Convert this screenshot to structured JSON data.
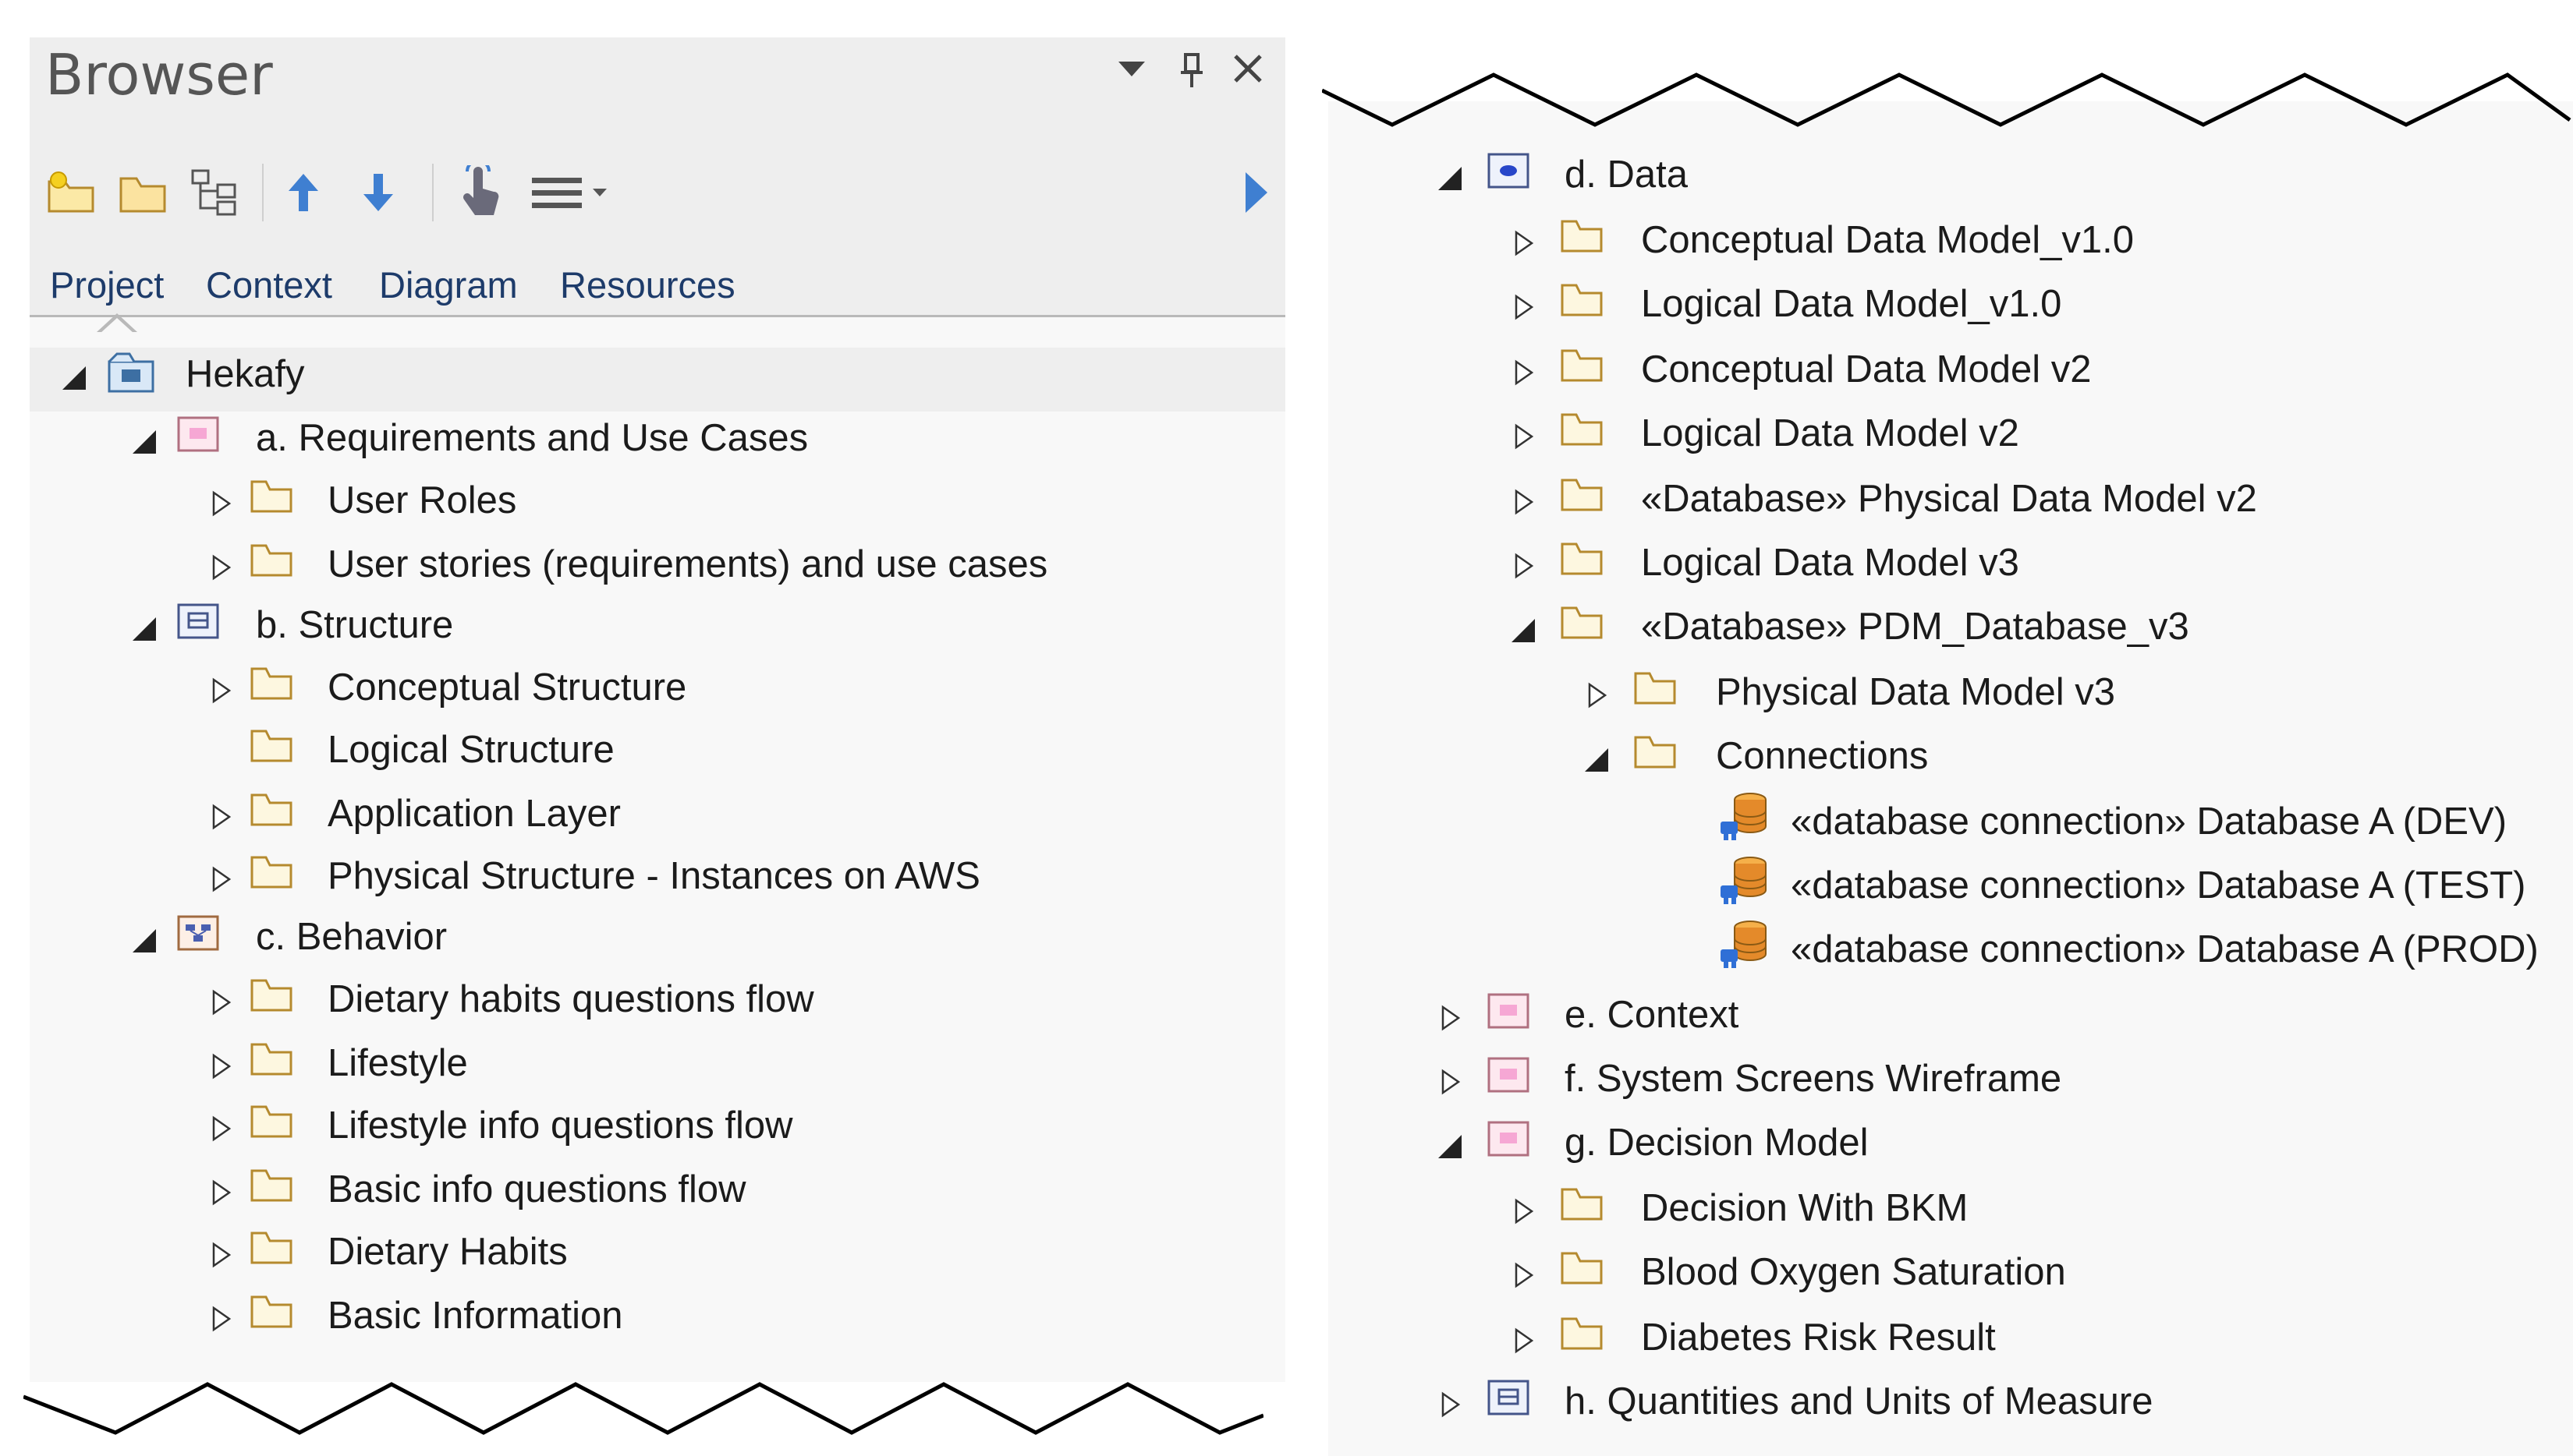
{
  "browser": {
    "title": "Browser",
    "controls": {
      "menu_glyph": "▾",
      "pin_glyph": "📌",
      "close_glyph": "✕"
    },
    "toolbar": {
      "icons": [
        "new-package-icon",
        "folder-icon",
        "hierarchy-icon",
        "arrow-up-icon",
        "arrow-down-icon",
        "touch-icon",
        "list-menu-icon",
        "play-icon"
      ]
    },
    "tabs": [
      "Project",
      "Context",
      "Diagram",
      "Resources"
    ],
    "active_tab": "Project"
  },
  "tree_left": [
    {
      "label": "Hekafy",
      "icon": "model-root-icon",
      "expander": "expanded"
    },
    {
      "label": "a. Requirements and Use Cases",
      "icon": "package-pink-icon",
      "expander": "expanded"
    },
    {
      "label": "User Roles",
      "icon": "folder-icon",
      "expander": "collapsed"
    },
    {
      "label": "User stories (requirements) and use cases",
      "icon": "folder-icon",
      "expander": "collapsed"
    },
    {
      "label": "b. Structure",
      "icon": "package-blue-icon",
      "expander": "expanded"
    },
    {
      "label": "Conceptual Structure",
      "icon": "folder-icon",
      "expander": "collapsed"
    },
    {
      "label": "Logical Structure",
      "icon": "folder-icon",
      "expander": "none"
    },
    {
      "label": "Application Layer",
      "icon": "folder-icon",
      "expander": "collapsed"
    },
    {
      "label": "Physical Structure - Instances on AWS",
      "icon": "folder-icon",
      "expander": "collapsed"
    },
    {
      "label": "c. Behavior",
      "icon": "package-behavior-icon",
      "expander": "expanded"
    },
    {
      "label": "Dietary habits questions flow",
      "icon": "folder-icon",
      "expander": "collapsed"
    },
    {
      "label": "Lifestyle",
      "icon": "folder-icon",
      "expander": "collapsed"
    },
    {
      "label": "Lifestyle info questions flow",
      "icon": "folder-icon",
      "expander": "collapsed"
    },
    {
      "label": "Basic info questions flow",
      "icon": "folder-icon",
      "expander": "collapsed"
    },
    {
      "label": "Dietary Habits",
      "icon": "folder-icon",
      "expander": "collapsed"
    },
    {
      "label": "Basic Information",
      "icon": "folder-icon",
      "expander": "collapsed"
    }
  ],
  "tree_right": [
    {
      "label": "d.  Data",
      "icon": "package-data-icon",
      "expander": "expanded"
    },
    {
      "label": "Conceptual Data Model_v1.0",
      "icon": "folder-icon",
      "expander": "collapsed"
    },
    {
      "label": "Logical Data Model_v1.0",
      "icon": "folder-icon",
      "expander": "collapsed"
    },
    {
      "label": "Conceptual Data Model v2",
      "icon": "folder-icon",
      "expander": "collapsed"
    },
    {
      "label": "Logical Data Model v2",
      "icon": "folder-icon",
      "expander": "collapsed"
    },
    {
      "label": "«Database» Physical Data Model v2",
      "icon": "folder-icon",
      "expander": "collapsed"
    },
    {
      "label": "Logical Data Model v3",
      "icon": "folder-icon",
      "expander": "collapsed"
    },
    {
      "label": "«Database» PDM_Database_v3",
      "icon": "folder-icon",
      "expander": "expanded"
    },
    {
      "label": "Physical Data Model v3",
      "icon": "folder-icon",
      "expander": "collapsed"
    },
    {
      "label": "Connections",
      "icon": "folder-icon",
      "expander": "expanded"
    },
    {
      "label": "«database connection» Database A (DEV)",
      "icon": "database-connection-icon",
      "expander": "none"
    },
    {
      "label": "«database connection» Database A (TEST)",
      "icon": "database-connection-icon",
      "expander": "none"
    },
    {
      "label": "«database connection» Database A (PROD)",
      "icon": "database-connection-icon",
      "expander": "none"
    },
    {
      "label": "e. Context",
      "icon": "package-pink-icon",
      "expander": "collapsed"
    },
    {
      "label": "f. System Screens Wireframe",
      "icon": "package-pink-icon",
      "expander": "collapsed"
    },
    {
      "label": "g. Decision Model",
      "icon": "package-pink-icon",
      "expander": "expanded"
    },
    {
      "label": "Decision With BKM",
      "icon": "folder-icon",
      "expander": "collapsed"
    },
    {
      "label": "Blood Oxygen Saturation",
      "icon": "folder-icon",
      "expander": "collapsed"
    },
    {
      "label": "Diabetes Risk Result",
      "icon": "folder-icon",
      "expander": "collapsed"
    },
    {
      "label": "h. Quantities and Units of Measure",
      "icon": "package-blue-icon",
      "expander": "collapsed"
    }
  ],
  "colors": {
    "panel_bg": "#f8f8f8",
    "chrome_bg": "#eeeeee",
    "tab_text": "#1d3b6a",
    "folder_stroke": "#b58a2e",
    "folder_fill": "#fbf3d6",
    "toolbar_arrow": "#3f7fd1"
  }
}
